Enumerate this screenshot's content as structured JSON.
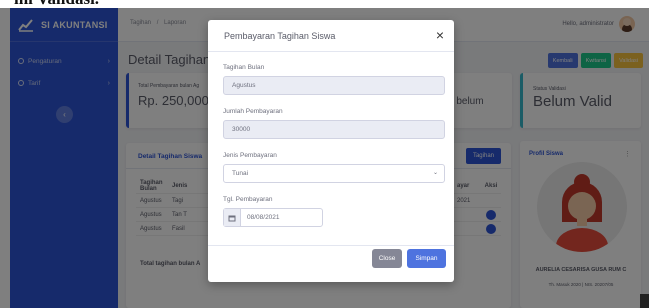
{
  "caption": "ini Validasi.",
  "sidebar": {
    "brand": "SI AKUNTANSI",
    "items": [
      {
        "label": "Pengaturan"
      },
      {
        "label": "Tarif"
      }
    ]
  },
  "topbar": {
    "crumbs": [
      "Tagihan",
      "/",
      "Laporan"
    ],
    "user": "Hello, administrator"
  },
  "page": {
    "title": "Detail Tagihan Si",
    "buttons": [
      {
        "label": "Kembali",
        "color": "#4e73df"
      },
      {
        "label": "Kwitansi",
        "color": "#1cc88a"
      },
      {
        "label": "Validasi",
        "color": "#f6c23e"
      }
    ]
  },
  "cards": {
    "total_label": "Total Pembayaran bulan Ag",
    "total_value": "Rp. 250,000",
    "mid_value": "n belum",
    "status_label": "Status Validasi",
    "status_value": "Belum Valid"
  },
  "detail": {
    "title": "Detail Tagihan Siswa",
    "tag_button": "Tagihan",
    "headers": [
      "Tagihan Bulan",
      "Jenis",
      "ayar",
      "Aksi"
    ],
    "rows": [
      [
        "Agustus",
        "Tagi",
        "2021",
        ""
      ],
      [
        "Agustus",
        "Tan T",
        "",
        ""
      ],
      [
        "Agustus",
        "Fasil",
        "",
        ""
      ]
    ],
    "total": "Total tagihan bulan A"
  },
  "profile": {
    "title": "Profil Siswa",
    "name": "AURELIA CESARISA GUSA RUM C",
    "sub": "Th. Masuk 2020 | NIS. 20207/05"
  },
  "modal": {
    "title": "Pembayaran Tagihan Siswa",
    "close_icon": "×",
    "field_bulan_label": "Tagihan Bulan",
    "field_bulan_value": "Agustus",
    "field_jumlah_label": "Jumlah Pembayaran",
    "field_jumlah_value": "30000",
    "field_jenis_label": "Jenis Pembayaran",
    "field_jenis_value": "Tunai",
    "field_tgl_label": "Tgl. Pembayaran",
    "field_tgl_value": "08/08/2021",
    "btn_close": "Close",
    "btn_save": "Simpan"
  },
  "colors": {
    "sidebar": "#2d54d6",
    "primary": "#4e73df",
    "secondary": "#858796"
  }
}
